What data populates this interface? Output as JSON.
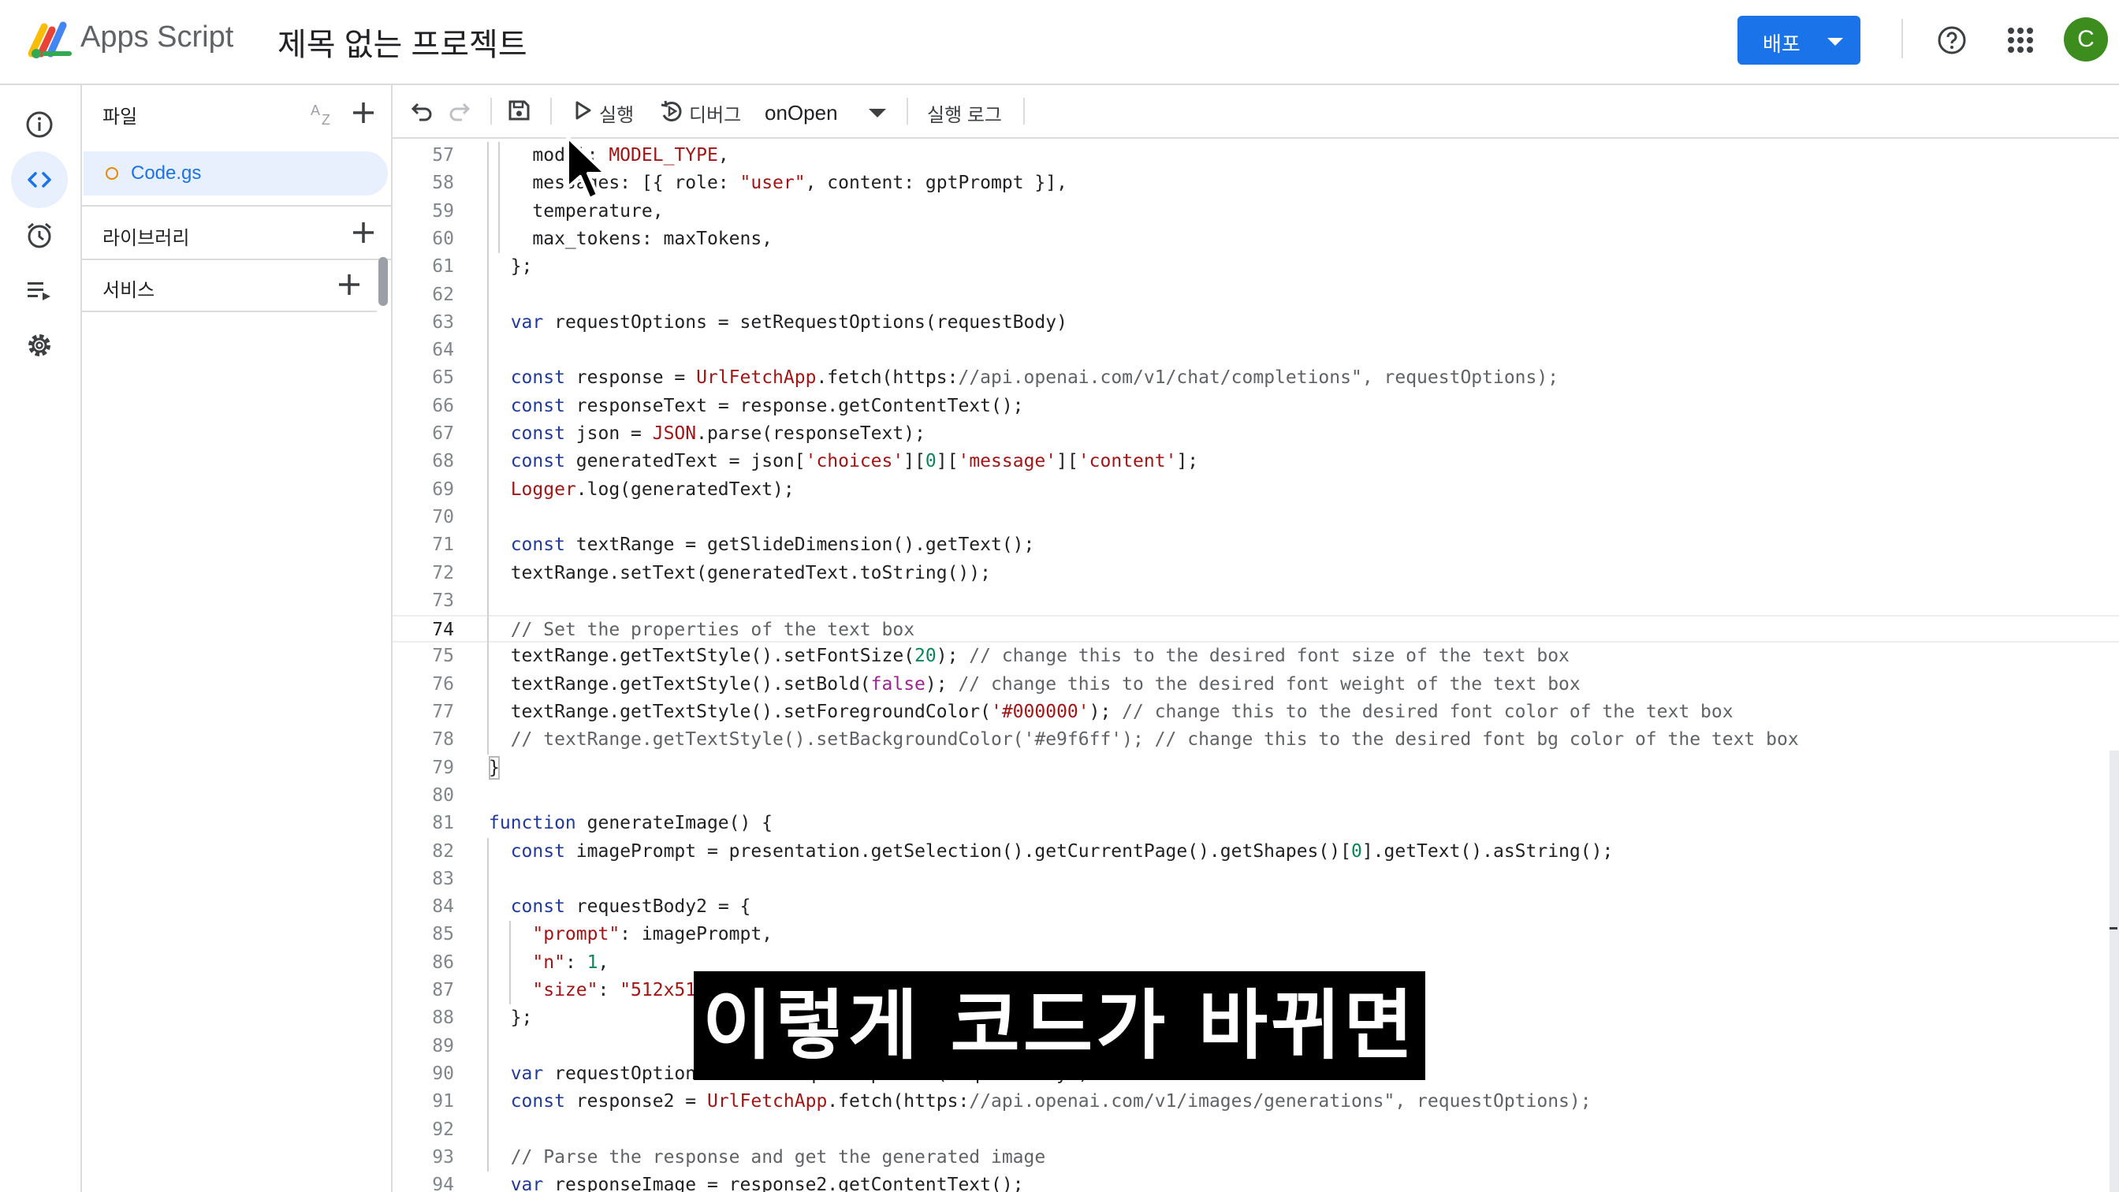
{
  "header": {
    "app_name": "Apps Script",
    "project_title": "제목 없는 프로젝트",
    "deploy_label": "배포",
    "avatar_letter": "C"
  },
  "rail": {
    "items": [
      "overview-icon",
      "editor-icon",
      "triggers-icon",
      "executions-icon",
      "settings-icon"
    ],
    "active": "editor-icon"
  },
  "files_panel": {
    "files_label": "파일",
    "files": [
      {
        "name": "Code.gs"
      }
    ],
    "libraries_label": "라이브러리",
    "services_label": "서비스"
  },
  "toolbar": {
    "run_label": "실행",
    "debug_label": "디버그",
    "function_name": "onOpen",
    "exec_log_label": "실행 로그"
  },
  "editor": {
    "current_line": 74,
    "lines": [
      {
        "n": "57",
        "text": "    model: MODEL_TYPE,"
      },
      {
        "n": "58",
        "text": "    messages: [{ role: \"user\", content: gptPrompt }],"
      },
      {
        "n": "59",
        "text": "    temperature,"
      },
      {
        "n": "60",
        "text": "    max_tokens: maxTokens,"
      },
      {
        "n": "61",
        "text": "  };"
      },
      {
        "n": "62",
        "text": ""
      },
      {
        "n": "63",
        "text": "  var requestOptions = setRequestOptions(requestBody)"
      },
      {
        "n": "64",
        "text": ""
      },
      {
        "n": "65",
        "text": "  const response = UrlFetchApp.fetch(\"https://api.openai.com/v1/chat/completions\", requestOptions);"
      },
      {
        "n": "66",
        "text": "  const responseText = response.getContentText();"
      },
      {
        "n": "67",
        "text": "  const json = JSON.parse(responseText);"
      },
      {
        "n": "68",
        "text": "  const generatedText = json['choices'][0]['message']['content'];"
      },
      {
        "n": "69",
        "text": "  Logger.log(generatedText);"
      },
      {
        "n": "70",
        "text": ""
      },
      {
        "n": "71",
        "text": "  const textRange = getSlideDimension().getText();"
      },
      {
        "n": "72",
        "text": "  textRange.setText(generatedText.toString());"
      },
      {
        "n": "73",
        "text": ""
      },
      {
        "n": "74",
        "text": "  // Set the properties of the text box"
      },
      {
        "n": "75",
        "text": "  textRange.getTextStyle().setFontSize(20); // change this to the desired font size of the text box"
      },
      {
        "n": "76",
        "text": "  textRange.getTextStyle().setBold(false); // change this to the desired font weight of the text box"
      },
      {
        "n": "77",
        "text": "  textRange.getTextStyle().setForegroundColor('#000000'); // change this to the desired font color of the text box"
      },
      {
        "n": "78",
        "text": "  // textRange.getTextStyle().setBackgroundColor('#e9f6ff'); // change this to the desired font bg color of the text box"
      },
      {
        "n": "79",
        "text": "}"
      },
      {
        "n": "80",
        "text": ""
      },
      {
        "n": "81",
        "text": "function generateImage() {"
      },
      {
        "n": "82",
        "text": "  const imagePrompt = presentation.getSelection().getCurrentPage().getShapes()[0].getText().asString();"
      },
      {
        "n": "83",
        "text": ""
      },
      {
        "n": "84",
        "text": "  const requestBody2 = {"
      },
      {
        "n": "85",
        "text": "    \"prompt\": imagePrompt,"
      },
      {
        "n": "86",
        "text": "    \"n\": 1,"
      },
      {
        "n": "87",
        "text": "    \"size\": \"512x512\""
      },
      {
        "n": "88",
        "text": "  };"
      },
      {
        "n": "89",
        "text": ""
      },
      {
        "n": "90",
        "text": "  var requestOptions2 = setRequestOptions(requestBody2)"
      },
      {
        "n": "91",
        "text": "  const response2 = UrlFetchApp.fetch(\"https://api.openai.com/v1/images/generations\", requestOptions);"
      },
      {
        "n": "92",
        "text": ""
      },
      {
        "n": "93",
        "text": "  // Parse the response and get the generated image"
      },
      {
        "n": "94",
        "text": "  var responseImage = response2.getContentText();"
      }
    ]
  },
  "subtitle": "이렇게 코드가 바뀌면",
  "colors": {
    "accent": "#1a73e8",
    "keyword": "#1f3a9a",
    "string": "#a31515",
    "comment": "#5f6368",
    "number": "#098658",
    "avatar": "#3c8c1e"
  }
}
